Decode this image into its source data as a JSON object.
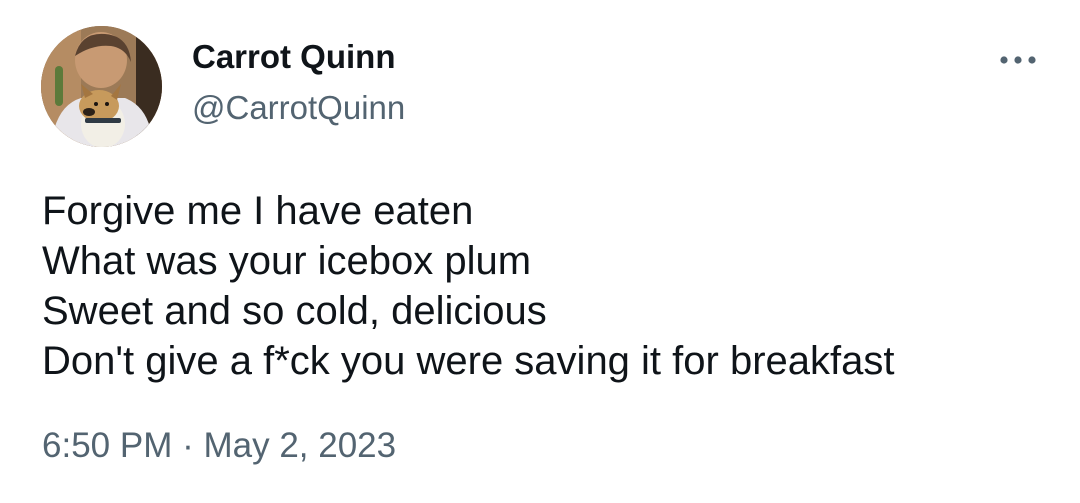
{
  "author": {
    "display_name": "Carrot Quinn",
    "handle": "@CarrotQuinn",
    "avatar_icon": "profile-photo-person-with-dog"
  },
  "more_icon": "more-horizontal-icon",
  "tweet": {
    "lines": [
      "Forgive me I have eaten",
      "What was your icebox plum",
      "Sweet and so cold, delicious",
      "Don't give a f*ck you were saving it for breakfast"
    ]
  },
  "meta": {
    "time": "6:50 PM",
    "separator": "·",
    "date": "May 2, 2023"
  },
  "colors": {
    "text_primary": "#0f1419",
    "text_secondary": "#536471",
    "background": "#ffffff"
  }
}
